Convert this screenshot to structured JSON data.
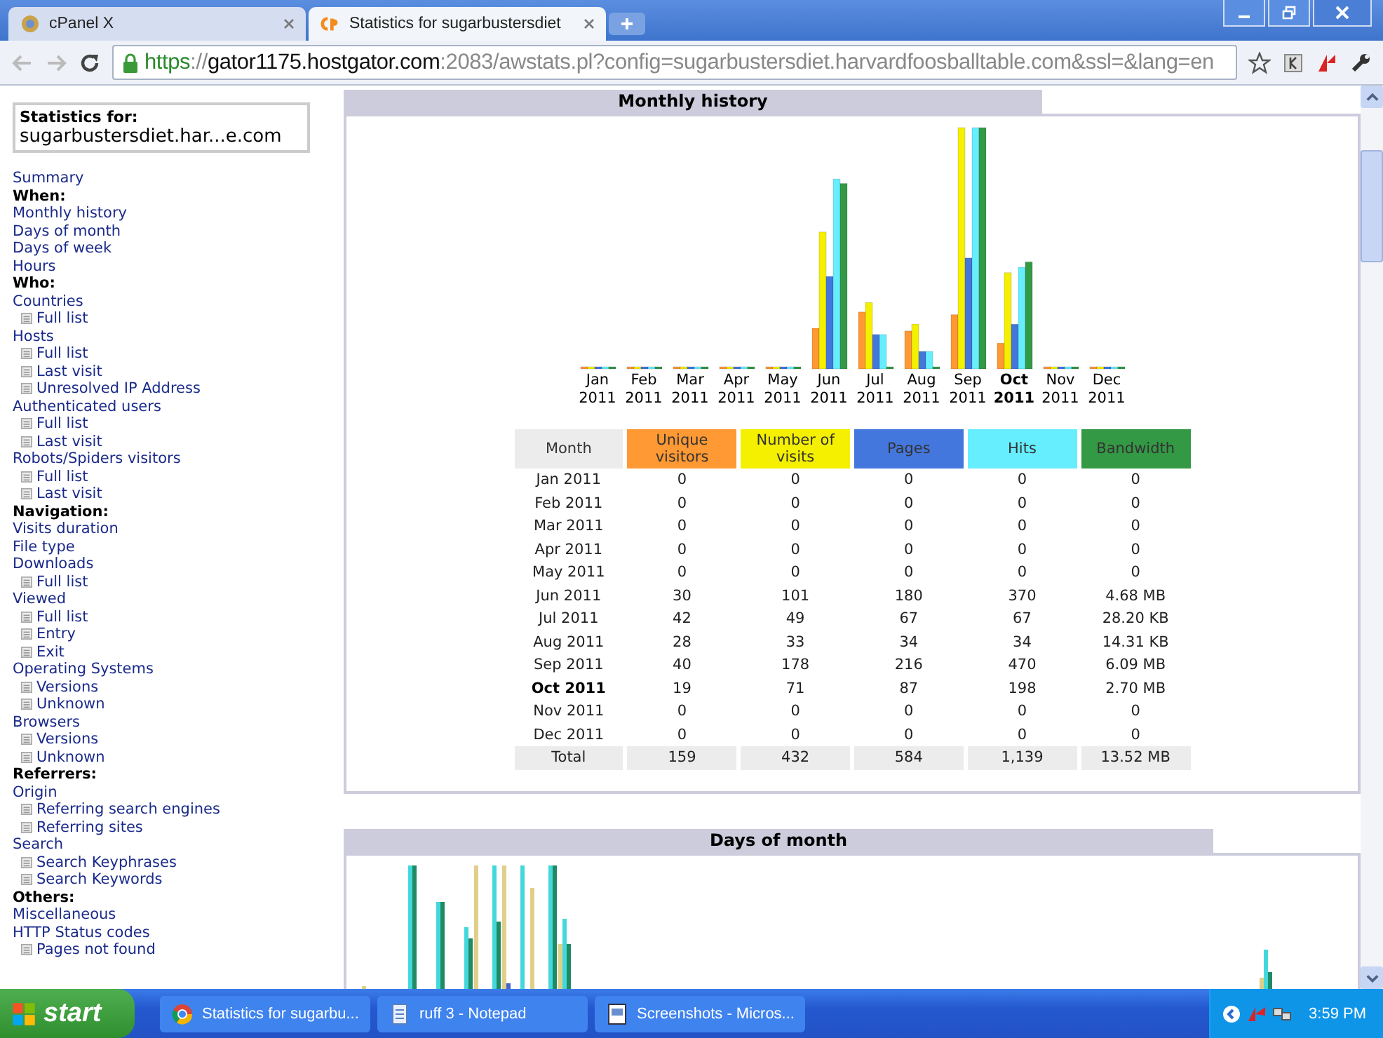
{
  "browser": {
    "tabs": [
      {
        "title": "cPanel X",
        "selected": false
      },
      {
        "title": "Statistics for sugarbustersdiet",
        "selected": true
      }
    ],
    "url": {
      "scheme": "https",
      "separator": "://",
      "host": "gator1175.hostgator.com",
      "path": ":2083/awstats.pl?config=sugarbustersdiet.harvardfoosballtable.com&ssl=&lang=en"
    }
  },
  "sidebar": {
    "stats_label": "Statistics for:",
    "site": "sugarbustersdiet.har...e.com",
    "items": [
      {
        "kind": "link",
        "label": "Summary"
      },
      {
        "kind": "heading",
        "label": "When:"
      },
      {
        "kind": "link",
        "label": "Monthly history"
      },
      {
        "kind": "link",
        "label": "Days of month"
      },
      {
        "kind": "link",
        "label": "Days of week"
      },
      {
        "kind": "link",
        "label": "Hours"
      },
      {
        "kind": "heading",
        "label": "Who:"
      },
      {
        "kind": "link",
        "label": "Countries",
        "children": [
          {
            "label": "Full list"
          }
        ]
      },
      {
        "kind": "link",
        "label": "Hosts",
        "children": [
          {
            "label": "Full list"
          },
          {
            "label": "Last visit"
          },
          {
            "label": "Unresolved IP Address"
          }
        ]
      },
      {
        "kind": "link",
        "label": "Authenticated users",
        "children": [
          {
            "label": "Full list"
          },
          {
            "label": "Last visit"
          }
        ]
      },
      {
        "kind": "link",
        "label": "Robots/Spiders visitors",
        "children": [
          {
            "label": "Full list"
          },
          {
            "label": "Last visit"
          }
        ]
      },
      {
        "kind": "heading",
        "label": "Navigation:"
      },
      {
        "kind": "link",
        "label": "Visits duration"
      },
      {
        "kind": "link",
        "label": "File type"
      },
      {
        "kind": "link",
        "label": "Downloads",
        "children": [
          {
            "label": "Full list"
          }
        ]
      },
      {
        "kind": "link",
        "label": "Viewed",
        "children": [
          {
            "label": "Full list"
          },
          {
            "label": "Entry"
          },
          {
            "label": "Exit"
          }
        ]
      },
      {
        "kind": "link",
        "label": "Operating Systems",
        "children": [
          {
            "label": "Versions"
          },
          {
            "label": "Unknown"
          }
        ]
      },
      {
        "kind": "link",
        "label": "Browsers",
        "children": [
          {
            "label": "Versions"
          },
          {
            "label": "Unknown"
          }
        ]
      },
      {
        "kind": "heading",
        "label": "Referrers:"
      },
      {
        "kind": "link",
        "label": "Origin",
        "children": [
          {
            "label": "Referring search engines"
          },
          {
            "label": "Referring sites"
          }
        ]
      },
      {
        "kind": "link",
        "label": "Search",
        "children": [
          {
            "label": "Search Keyphrases"
          },
          {
            "label": "Search Keywords"
          }
        ]
      },
      {
        "kind": "heading",
        "label": "Others:"
      },
      {
        "kind": "link",
        "label": "Miscellaneous"
      },
      {
        "kind": "link",
        "label": "HTTP Status codes",
        "children": [
          {
            "label": "Pages not found"
          }
        ]
      }
    ]
  },
  "monthly_history": {
    "title": "Monthly history",
    "x_labels": [
      {
        "month": "Jan",
        "year": "2011",
        "current": false
      },
      {
        "month": "Feb",
        "year": "2011",
        "current": false
      },
      {
        "month": "Mar",
        "year": "2011",
        "current": false
      },
      {
        "month": "Apr",
        "year": "2011",
        "current": false
      },
      {
        "month": "May",
        "year": "2011",
        "current": false
      },
      {
        "month": "Jun",
        "year": "2011",
        "current": false
      },
      {
        "month": "Jul",
        "year": "2011",
        "current": false
      },
      {
        "month": "Aug",
        "year": "2011",
        "current": false
      },
      {
        "month": "Sep",
        "year": "2011",
        "current": false
      },
      {
        "month": "Oct",
        "year": "2011",
        "current": true
      },
      {
        "month": "Nov",
        "year": "2011",
        "current": false
      },
      {
        "month": "Dec",
        "year": "2011",
        "current": false
      }
    ],
    "table": {
      "columns": [
        {
          "label": "Month",
          "color": "#ececec"
        },
        {
          "label": "Unique visitors",
          "color": "#ff9933"
        },
        {
          "label": "Number of visits",
          "color": "#f4f000"
        },
        {
          "label": "Pages",
          "color": "#4477dd"
        },
        {
          "label": "Hits",
          "color": "#66eeff"
        },
        {
          "label": "Bandwidth",
          "color": "#339944"
        }
      ],
      "rows": [
        {
          "current": false,
          "cells": [
            "Jan 2011",
            "0",
            "0",
            "0",
            "0",
            "0"
          ]
        },
        {
          "current": false,
          "cells": [
            "Feb 2011",
            "0",
            "0",
            "0",
            "0",
            "0"
          ]
        },
        {
          "current": false,
          "cells": [
            "Mar 2011",
            "0",
            "0",
            "0",
            "0",
            "0"
          ]
        },
        {
          "current": false,
          "cells": [
            "Apr 2011",
            "0",
            "0",
            "0",
            "0",
            "0"
          ]
        },
        {
          "current": false,
          "cells": [
            "May 2011",
            "0",
            "0",
            "0",
            "0",
            "0"
          ]
        },
        {
          "current": false,
          "cells": [
            "Jun 2011",
            "30",
            "101",
            "180",
            "370",
            "4.68 MB"
          ]
        },
        {
          "current": false,
          "cells": [
            "Jul 2011",
            "42",
            "49",
            "67",
            "67",
            "28.20 KB"
          ]
        },
        {
          "current": false,
          "cells": [
            "Aug 2011",
            "28",
            "33",
            "34",
            "34",
            "14.31 KB"
          ]
        },
        {
          "current": false,
          "cells": [
            "Sep 2011",
            "40",
            "178",
            "216",
            "470",
            "6.09 MB"
          ]
        },
        {
          "current": true,
          "cells": [
            "Oct 2011",
            "19",
            "71",
            "87",
            "198",
            "2.70 MB"
          ]
        },
        {
          "current": false,
          "cells": [
            "Nov 2011",
            "0",
            "0",
            "0",
            "0",
            "0"
          ]
        },
        {
          "current": false,
          "cells": [
            "Dec 2011",
            "0",
            "0",
            "0",
            "0",
            "0"
          ]
        }
      ],
      "total": [
        "Total",
        "159",
        "432",
        "584",
        "1,139",
        "13.52 MB"
      ]
    }
  },
  "days_of_month": {
    "title": "Days of month"
  },
  "taskbar": {
    "start": "start",
    "items": [
      {
        "label": "Statistics for sugarbu...",
        "kind": "browser"
      },
      {
        "label": "ruff 3 - Notepad",
        "kind": "notepad"
      },
      {
        "label": "Screenshots - Micros...",
        "kind": "document"
      }
    ],
    "clock": "3:59 PM"
  }
}
